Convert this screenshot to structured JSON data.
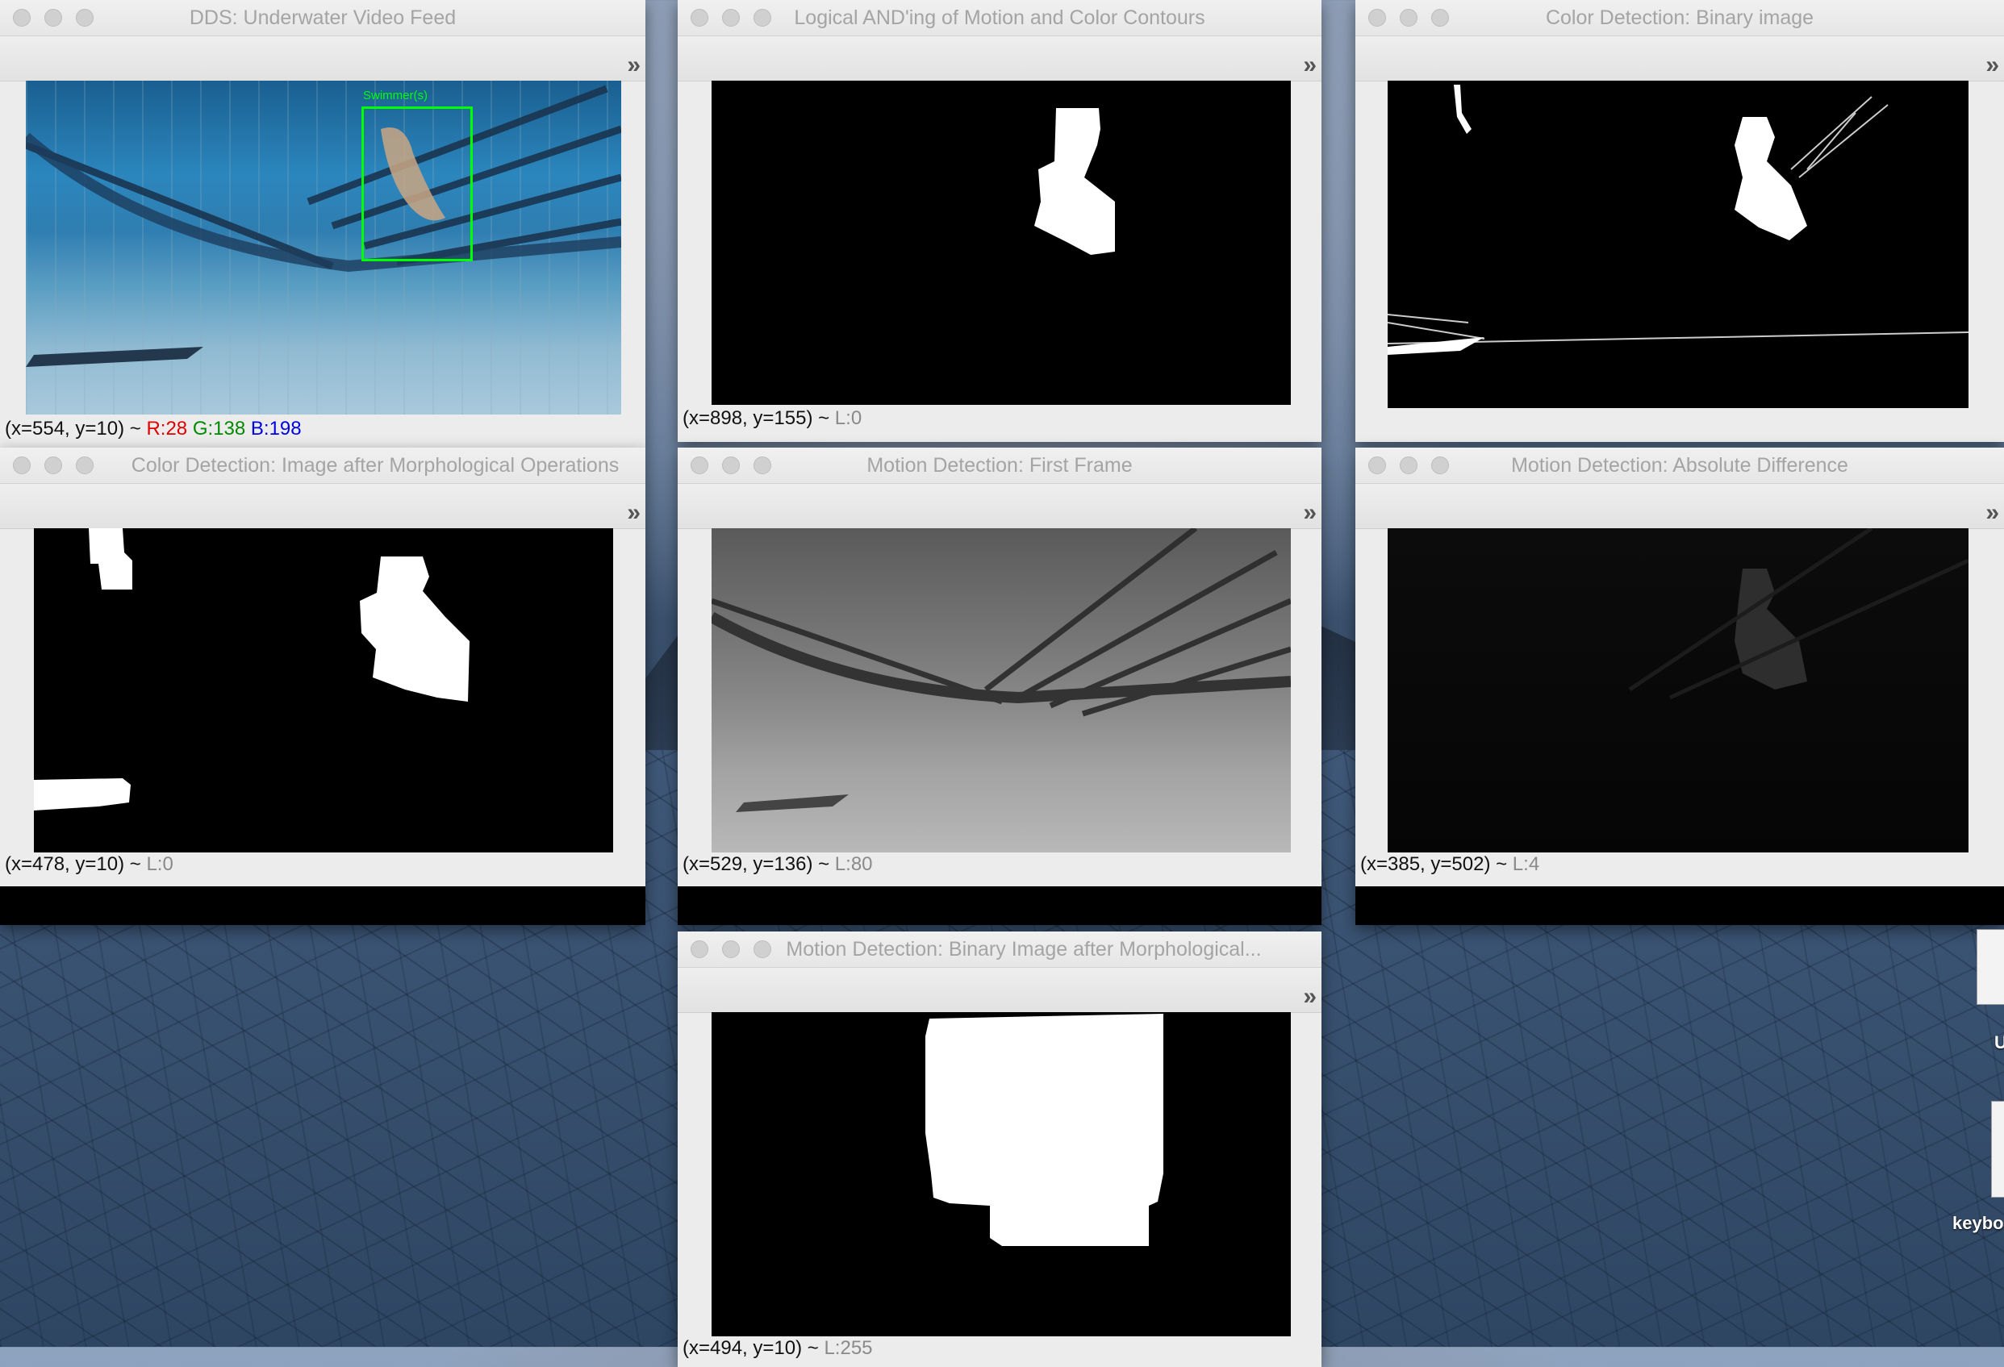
{
  "windows": [
    {
      "id": "video",
      "title": "DDS: Underwater Video Feed",
      "status_prefix": "(x=554, y=10) ~ ",
      "r": "R:28",
      "g": "G:138",
      "b": "B:198",
      "box_label": "Swimmer(s)"
    },
    {
      "id": "and",
      "title": "Logical AND'ing of Motion and Color Contours",
      "status_prefix": "(x=898, y=155) ~ ",
      "status_value": "L:0"
    },
    {
      "id": "color-binary",
      "title": "Color Detection: Binary image"
    },
    {
      "id": "color-morph",
      "title": "Color Detection: Image after Morphological Operations",
      "status_prefix": "(x=478, y=10) ~ ",
      "status_value": "L:0"
    },
    {
      "id": "first-frame",
      "title": "Motion Detection: First Frame",
      "status_prefix": "(x=529, y=136) ~ ",
      "status_value": "L:80"
    },
    {
      "id": "abs-diff",
      "title": "Motion Detection: Absolute Difference",
      "status_prefix": "(x=385, y=502) ~ ",
      "status_value": "L:4"
    },
    {
      "id": "motion-morph",
      "title": "Motion Detection: Binary Image after Morphological...",
      "status_prefix": "(x=494, y=10) ~ ",
      "status_value": "L:255"
    }
  ],
  "toolbar_chevron": "»",
  "desktop_icons": [
    {
      "label": "U"
    },
    {
      "label": "keybo"
    }
  ],
  "colors": {
    "r": "#e00000",
    "g": "#008a00",
    "b": "#0000e0",
    "box": "#00ff00"
  }
}
